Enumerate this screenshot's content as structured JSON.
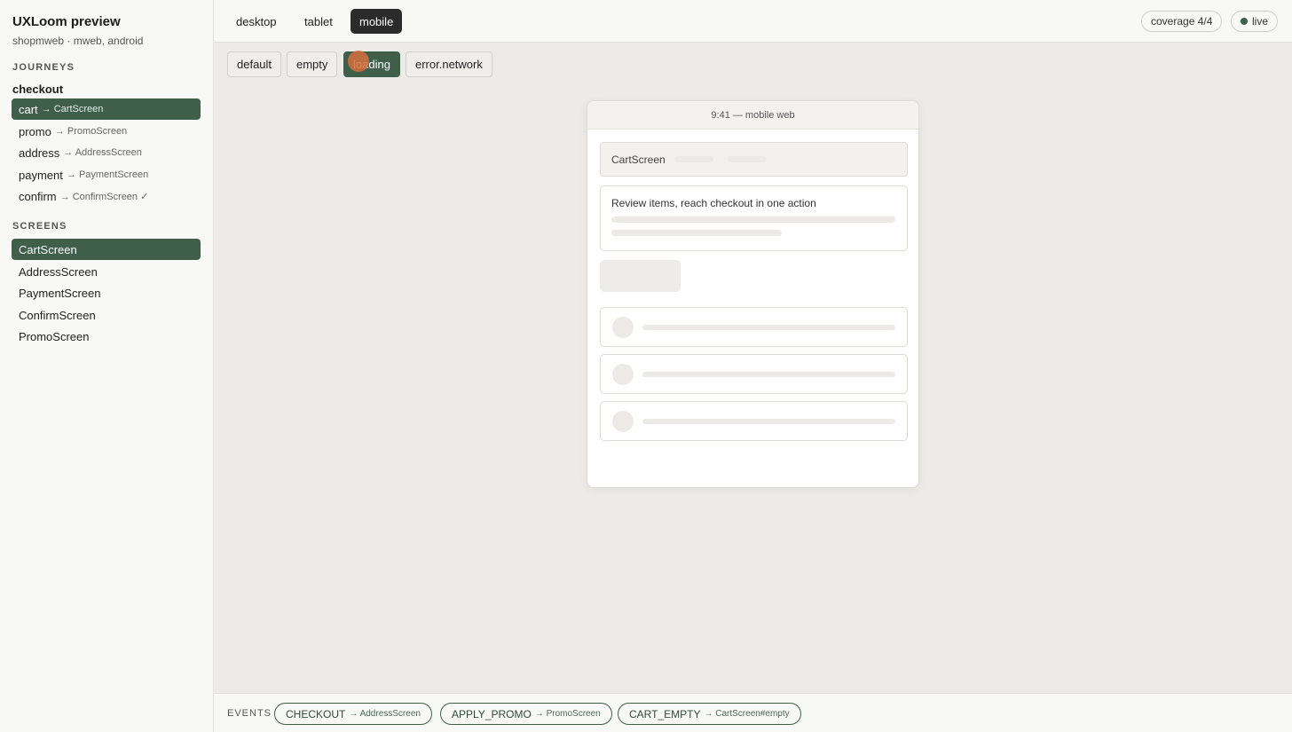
{
  "app": {
    "title": "UXLoom preview",
    "subtitle": "shopmweb · mweb, android"
  },
  "sidebar": {
    "journeys_label": "JOURNEYS",
    "journey_name": "checkout",
    "journey_steps": [
      {
        "name": "cart",
        "arrow": "→",
        "target": "CartScreen",
        "active": true
      },
      {
        "name": "promo",
        "arrow": "→",
        "target": "PromoScreen",
        "active": false
      },
      {
        "name": "address",
        "arrow": "→",
        "target": "AddressScreen",
        "active": false
      },
      {
        "name": "payment",
        "arrow": "→",
        "target": "PaymentScreen",
        "active": false
      },
      {
        "name": "confirm",
        "arrow": "→",
        "target": "ConfirmScreen ✓",
        "active": false
      }
    ],
    "screens_label": "SCREENS",
    "screens": [
      {
        "name": "CartScreen",
        "active": true
      },
      {
        "name": "AddressScreen",
        "active": false
      },
      {
        "name": "PaymentScreen",
        "active": false
      },
      {
        "name": "ConfirmScreen",
        "active": false
      },
      {
        "name": "PromoScreen",
        "active": false
      }
    ]
  },
  "topbar": {
    "viewports": [
      {
        "label": "desktop",
        "active": false
      },
      {
        "label": "tablet",
        "active": false
      },
      {
        "label": "mobile",
        "active": true
      }
    ],
    "coverage": "coverage 4/4",
    "live": "live"
  },
  "states": [
    {
      "label": "default",
      "active": false
    },
    {
      "label": "empty",
      "active": false
    },
    {
      "label": "loading",
      "active": true
    },
    {
      "label": "error.network",
      "active": false
    }
  ],
  "device": {
    "status": "9:41 — mobile web",
    "screen_name": "CartScreen",
    "description": "Review items, reach checkout in one action"
  },
  "events": {
    "label": "EVENTS",
    "items": [
      {
        "name": "CHECKOUT",
        "arrow": "→",
        "target": "AddressScreen"
      },
      {
        "name": "APPLY_PROMO",
        "arrow": "→",
        "target": "PromoScreen"
      },
      {
        "name": "CART_EMPTY",
        "arrow": "→",
        "target": "CartScreen#empty"
      }
    ]
  },
  "colors": {
    "accent": "#3f5f4b",
    "dark": "#2b2b2b",
    "cursor": "#d66e3c"
  }
}
